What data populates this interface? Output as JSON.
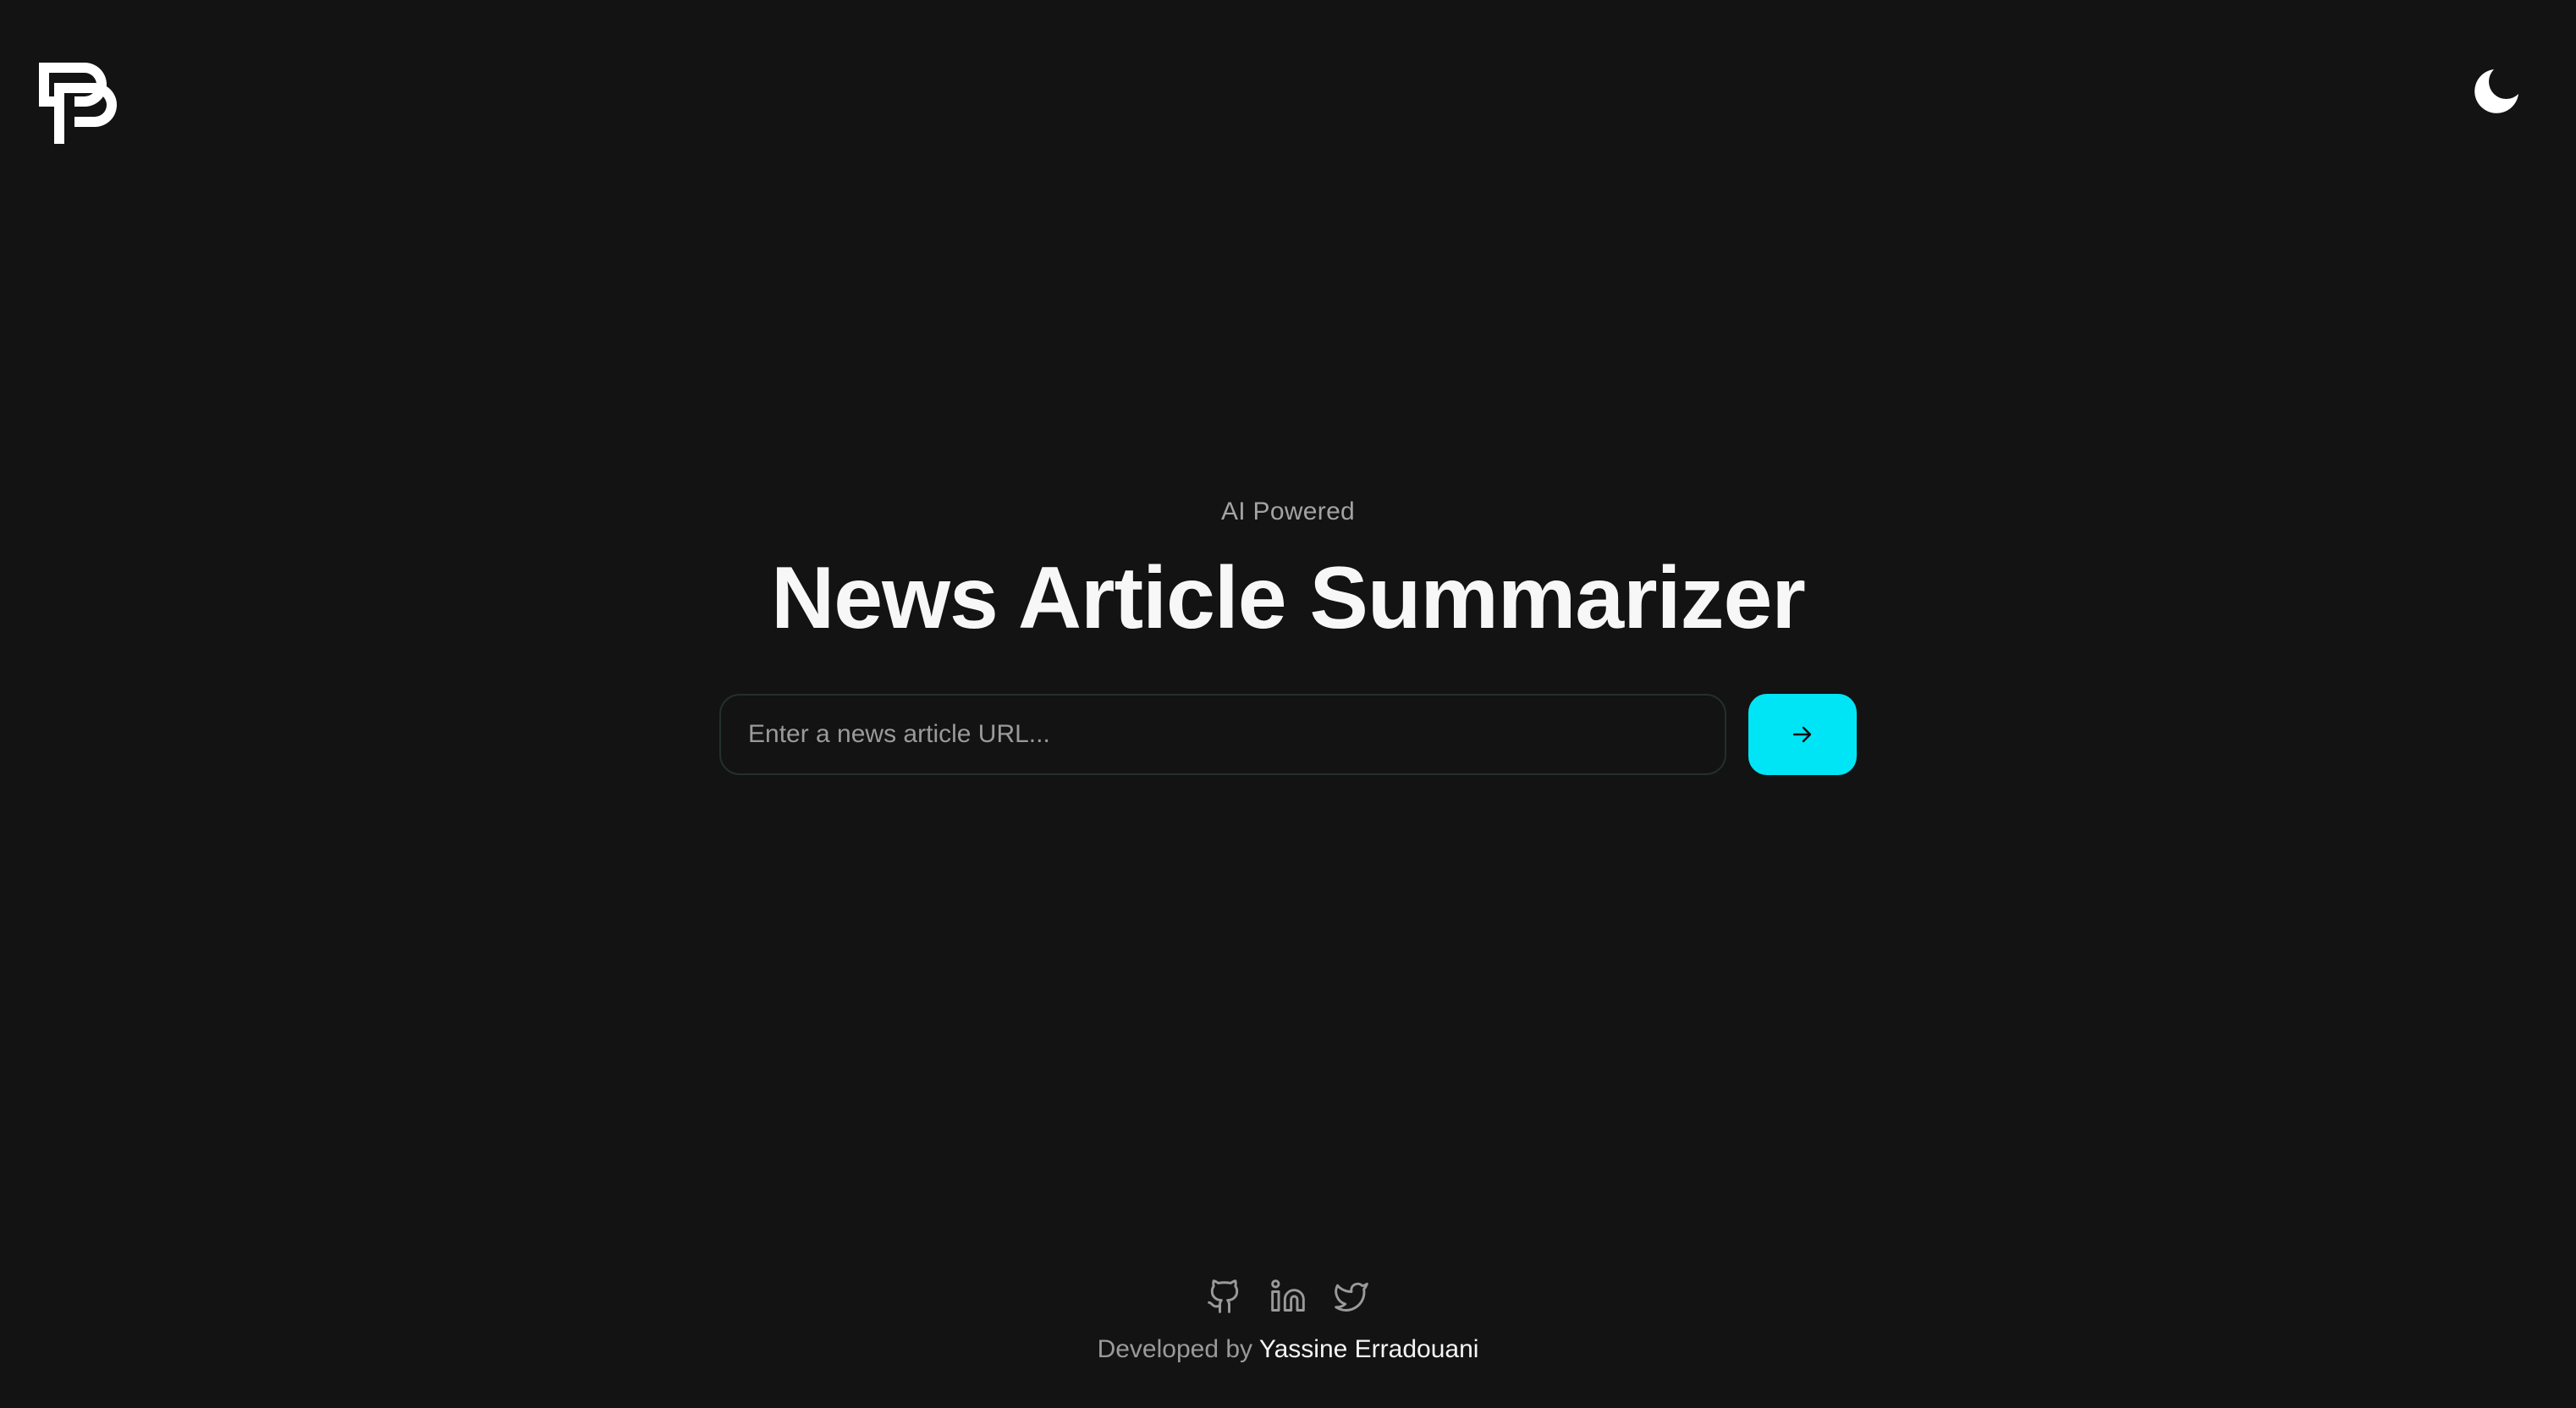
{
  "header": {
    "logo_icon": "brand-logo-icon",
    "theme_toggle_icon": "moon-icon"
  },
  "hero": {
    "tagline": "AI Powered",
    "title": "News Article Summarizer"
  },
  "search": {
    "placeholder": "Enter a news article URL...",
    "value": "",
    "submit_icon": "arrow-right-icon"
  },
  "footer": {
    "social_icons": [
      "github-icon",
      "linkedin-icon",
      "twitter-icon"
    ],
    "credit_prefix": "Developed by",
    "author": "Yassine Erradouani"
  },
  "colors": {
    "background": "#131313",
    "accent": "#00e5f5",
    "title": "#f7f7f7",
    "muted": "#a3a3a3"
  }
}
